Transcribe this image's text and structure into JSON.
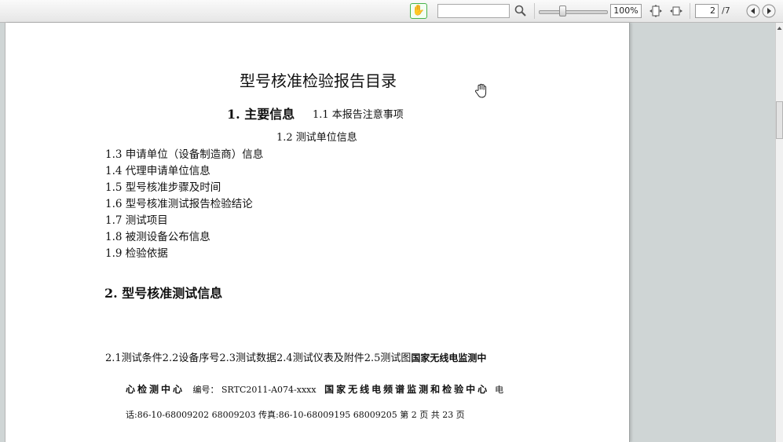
{
  "toolbar": {
    "tools": {
      "hand_icon": "hand-icon",
      "search_placeholder": "",
      "search_icon": "magnifier-icon"
    },
    "zoom": {
      "level_text": "100%",
      "level": 1.0
    },
    "page": {
      "current": "2",
      "total_text": "/7"
    }
  },
  "document": {
    "title": "型号核准检验报告目录",
    "section1": {
      "heading": "1.  主要信息",
      "inline_item": "1.1  本报告注意事项",
      "item_12": "1.2  测试单位信息",
      "items": [
        "1.3  申请单位（设备制造商）信息",
        "1.4  代理申请单位信息",
        "1.5  型号核准步骤及时间",
        "1.6  型号核准测试报告检验结论",
        "1.7  测试项目",
        "1.8  被测设备公布信息",
        "1.9  检验依据"
      ]
    },
    "section2": {
      "heading": "2.  型号核准测试信息",
      "items_line": "2.1测试条件2.2设备序号2.3测试数据2.4测试仪表及附件2.5测试图",
      "trailing_bold": "国家无线电监测中"
    },
    "footer": {
      "center_name_cont": "心检测中心",
      "number_label": "编号：",
      "number_value": "SRTC2011-A074-xxxx",
      "org_name": "国家无线电频谱监测和检验中心",
      "phone_prefix": "电",
      "line2": "话:86-10-68009202 68009203  传真:86-10-68009195 68009205  第 2 页 共 23 页"
    }
  }
}
